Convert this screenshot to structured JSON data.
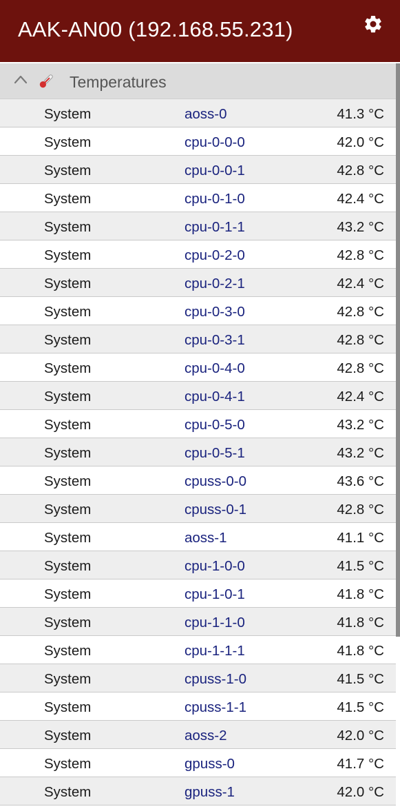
{
  "header": {
    "title": "AAK-AN00 (192.168.55.231)",
    "settings_icon": "gear-icon"
  },
  "section": {
    "title": "Temperatures",
    "collapse_icon": "chevron-up-icon",
    "section_icon": "thermometer-icon",
    "expanded": true
  },
  "colors": {
    "appbar": "#6d120d",
    "sensor_text": "#1a237e",
    "row_alt": "#eeeeee"
  },
  "rows": [
    {
      "source": "System",
      "sensor": "aoss-0",
      "value": "41.3 °C"
    },
    {
      "source": "System",
      "sensor": "cpu-0-0-0",
      "value": "42.0 °C"
    },
    {
      "source": "System",
      "sensor": "cpu-0-0-1",
      "value": "42.8 °C"
    },
    {
      "source": "System",
      "sensor": "cpu-0-1-0",
      "value": "42.4 °C"
    },
    {
      "source": "System",
      "sensor": "cpu-0-1-1",
      "value": "43.2 °C"
    },
    {
      "source": "System",
      "sensor": "cpu-0-2-0",
      "value": "42.8 °C"
    },
    {
      "source": "System",
      "sensor": "cpu-0-2-1",
      "value": "42.4 °C"
    },
    {
      "source": "System",
      "sensor": "cpu-0-3-0",
      "value": "42.8 °C"
    },
    {
      "source": "System",
      "sensor": "cpu-0-3-1",
      "value": "42.8 °C"
    },
    {
      "source": "System",
      "sensor": "cpu-0-4-0",
      "value": "42.8 °C"
    },
    {
      "source": "System",
      "sensor": "cpu-0-4-1",
      "value": "42.4 °C"
    },
    {
      "source": "System",
      "sensor": "cpu-0-5-0",
      "value": "43.2 °C"
    },
    {
      "source": "System",
      "sensor": "cpu-0-5-1",
      "value": "43.2 °C"
    },
    {
      "source": "System",
      "sensor": "cpuss-0-0",
      "value": "43.6 °C"
    },
    {
      "source": "System",
      "sensor": "cpuss-0-1",
      "value": "42.8 °C"
    },
    {
      "source": "System",
      "sensor": "aoss-1",
      "value": "41.1 °C"
    },
    {
      "source": "System",
      "sensor": "cpu-1-0-0",
      "value": "41.5 °C"
    },
    {
      "source": "System",
      "sensor": "cpu-1-0-1",
      "value": "41.8 °C"
    },
    {
      "source": "System",
      "sensor": "cpu-1-1-0",
      "value": "41.8 °C"
    },
    {
      "source": "System",
      "sensor": "cpu-1-1-1",
      "value": "41.8 °C"
    },
    {
      "source": "System",
      "sensor": "cpuss-1-0",
      "value": "41.5 °C"
    },
    {
      "source": "System",
      "sensor": "cpuss-1-1",
      "value": "41.5 °C"
    },
    {
      "source": "System",
      "sensor": "aoss-2",
      "value": "42.0 °C"
    },
    {
      "source": "System",
      "sensor": "gpuss-0",
      "value": "41.7 °C"
    },
    {
      "source": "System",
      "sensor": "gpuss-1",
      "value": "42.0 °C"
    }
  ]
}
